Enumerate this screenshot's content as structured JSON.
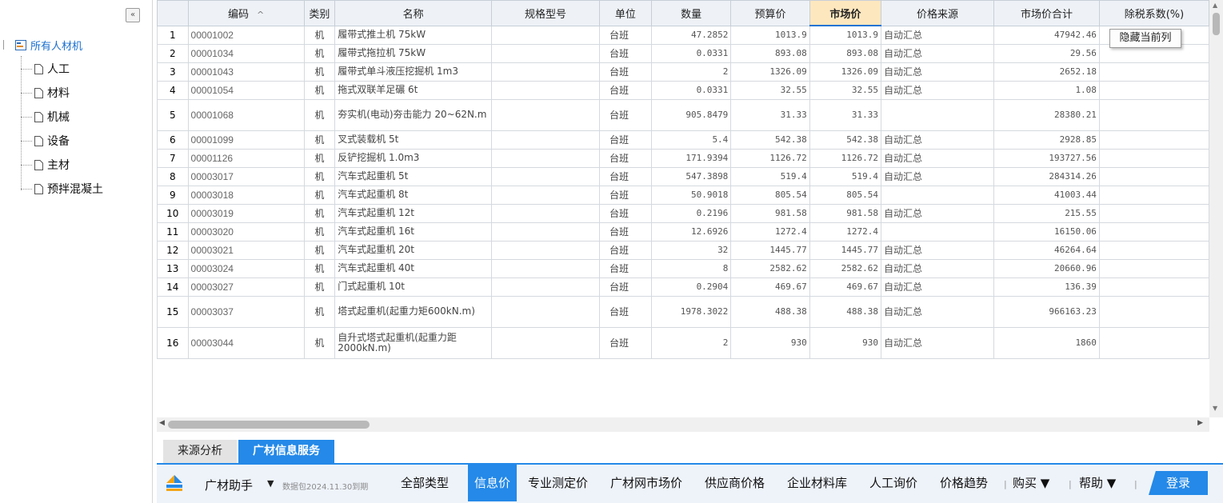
{
  "tree": {
    "collapse_glyph": "«",
    "root_label": "所有人材机",
    "children": [
      "人工",
      "材料",
      "机械",
      "设备",
      "主材",
      "预拌混凝土"
    ]
  },
  "grid": {
    "columns": [
      "",
      "编码",
      "类别",
      "名称",
      "规格型号",
      "单位",
      "数量",
      "预算价",
      "市场价",
      "价格来源",
      "市场价合计",
      "除税系数(%)"
    ],
    "sort_glyph": "^",
    "rows": [
      [
        "1",
        "00001002",
        "机",
        "履带式推土机 75kW",
        "",
        "台班",
        "47.2852",
        "1013.9",
        "1013.9",
        "自动汇总",
        "47942.46"
      ],
      [
        "2",
        "00001034",
        "机",
        "履带式拖拉机 75kW",
        "",
        "台班",
        "0.0331",
        "893.08",
        "893.08",
        "自动汇总",
        "29.56"
      ],
      [
        "3",
        "00001043",
        "机",
        "履带式单斗液压挖掘机 1m3",
        "",
        "台班",
        "2",
        "1326.09",
        "1326.09",
        "自动汇总",
        "2652.18"
      ],
      [
        "4",
        "00001054",
        "机",
        "拖式双联羊足碾 6t",
        "",
        "台班",
        "0.0331",
        "32.55",
        "32.55",
        "自动汇总",
        "1.08"
      ],
      [
        "5",
        "00001068",
        "机",
        "夯实机(电动)夯击能力 20~62N.m",
        "",
        "台班",
        "905.8479",
        "31.33",
        "31.33",
        "",
        "28380.21"
      ],
      [
        "6",
        "00001099",
        "机",
        "叉式装载机 5t",
        "",
        "台班",
        "5.4",
        "542.38",
        "542.38",
        "自动汇总",
        "2928.85"
      ],
      [
        "7",
        "00001126",
        "机",
        "反铲挖掘机 1.0m3",
        "",
        "台班",
        "171.9394",
        "1126.72",
        "1126.72",
        "自动汇总",
        "193727.56"
      ],
      [
        "8",
        "00003017",
        "机",
        "汽车式起重机 5t",
        "",
        "台班",
        "547.3898",
        "519.4",
        "519.4",
        "自动汇总",
        "284314.26"
      ],
      [
        "9",
        "00003018",
        "机",
        "汽车式起重机 8t",
        "",
        "台班",
        "50.9018",
        "805.54",
        "805.54",
        "",
        "41003.44"
      ],
      [
        "10",
        "00003019",
        "机",
        "汽车式起重机 12t",
        "",
        "台班",
        "0.2196",
        "981.58",
        "981.58",
        "自动汇总",
        "215.55"
      ],
      [
        "11",
        "00003020",
        "机",
        "汽车式起重机 16t",
        "",
        "台班",
        "12.6926",
        "1272.4",
        "1272.4",
        "",
        "16150.06"
      ],
      [
        "12",
        "00003021",
        "机",
        "汽车式起重机 20t",
        "",
        "台班",
        "32",
        "1445.77",
        "1445.77",
        "自动汇总",
        "46264.64"
      ],
      [
        "13",
        "00003024",
        "机",
        "汽车式起重机 40t",
        "",
        "台班",
        "8",
        "2582.62",
        "2582.62",
        "自动汇总",
        "20660.96"
      ],
      [
        "14",
        "00003027",
        "机",
        "门式起重机 10t",
        "",
        "台班",
        "0.2904",
        "469.67",
        "469.67",
        "自动汇总",
        "136.39"
      ],
      [
        "15",
        "00003037",
        "机",
        "塔式起重机(起重力矩600kN.m)",
        "",
        "台班",
        "1978.3022",
        "488.38",
        "488.38",
        "自动汇总",
        "966163.23"
      ],
      [
        "16",
        "00003044",
        "机",
        "自升式塔式起重机(起重力距2000kN.m)",
        "",
        "台班",
        "2",
        "930",
        "930",
        "自动汇总",
        "1860"
      ]
    ]
  },
  "tooltip": "隐藏当前列",
  "bottom_tabs": [
    "来源分析",
    "广材信息服务"
  ],
  "toolbar": {
    "brand": "广材助手",
    "brand_arrow": "▼",
    "package_date": "数据包2024.11.30到期",
    "items": [
      "全部类型",
      "信息价",
      "专业测定价",
      "广材网市场价",
      "供应商价格",
      "企业材料库",
      "人工询价",
      "价格趋势"
    ],
    "selected_item": "信息价",
    "buy_label": "购买 ▼",
    "help_label": "帮助 ▼",
    "login_label": "登录"
  },
  "colors": {
    "accent": "#2489e8",
    "active_column_header": "#fde7bf",
    "tree_root_text": "#1a6fcf"
  }
}
